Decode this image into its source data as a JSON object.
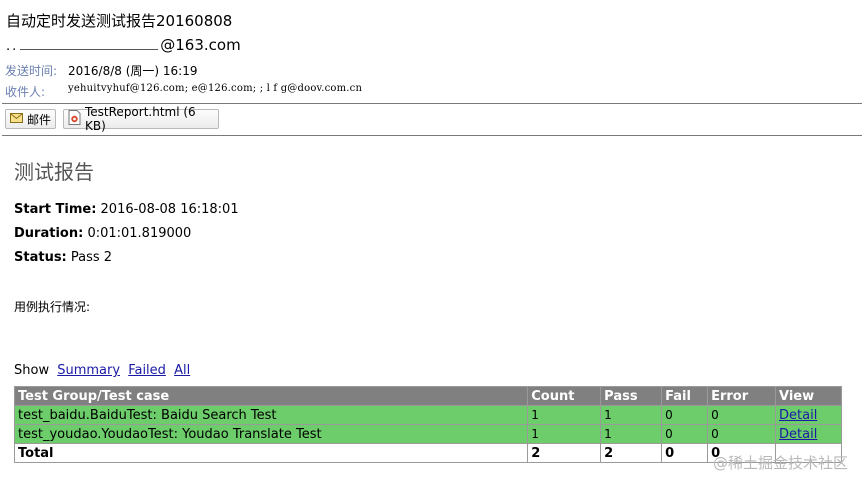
{
  "email": {
    "subject": "自动定时发送测试报告20160808",
    "from_prefix": "..",
    "from_suffix": "@163.com",
    "sent_label": "发送时间:",
    "sent_value": "2016/8/8 (周一) 16:19",
    "to_label": "收件人:",
    "to_value": "yehuitvyhuf@126.com;              e@126.com; ;      l   f   g@doov.com.cn"
  },
  "toolbar": {
    "mail_label": "邮件",
    "attachment_label": "TestReport.html (6 KB)"
  },
  "report": {
    "title": "测试报告",
    "start_label": "Start Time:",
    "start_value": "2016-08-08 16:18:01",
    "duration_label": "Duration:",
    "duration_value": "0:01:01.819000",
    "status_label": "Status:",
    "status_value": "Pass 2",
    "execution_label": "用例执行情况:",
    "show_label": "Show",
    "show_links": [
      "Summary",
      "Failed",
      "All"
    ]
  },
  "table": {
    "headers": [
      "Test Group/Test case",
      "Count",
      "Pass",
      "Fail",
      "Error",
      "View"
    ],
    "rows": [
      {
        "name": "test_baidu.BaiduTest: Baidu Search Test",
        "count": "1",
        "pass": "1",
        "fail": "0",
        "error": "0",
        "view": "Detail"
      },
      {
        "name": "test_youdao.YoudaoTest: Youdao Translate Test",
        "count": "1",
        "pass": "1",
        "fail": "0",
        "error": "0",
        "view": "Detail"
      }
    ],
    "total": {
      "name": "Total",
      "count": "2",
      "pass": "2",
      "fail": "0",
      "error": "0"
    }
  },
  "watermark": "@稀土掘金技术社区",
  "colors": {
    "pass_row": "#6ccd6a",
    "header_row": "#808080",
    "link": "#1a1aa6",
    "meta_label": "#6a7fb0"
  },
  "icons": {
    "mail": "envelope-icon",
    "attachment": "html-file-icon"
  }
}
